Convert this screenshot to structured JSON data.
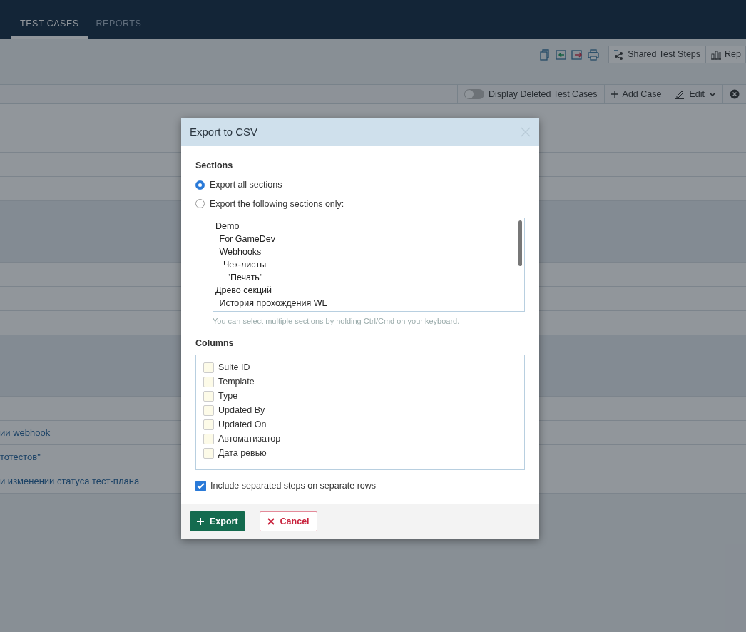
{
  "nav_tabs": [
    {
      "label": "TEST CASES",
      "selected": true
    },
    {
      "label": "REPORTS",
      "selected": false
    }
  ],
  "toolbar": {
    "buttons": [
      {
        "label": "Shared Test Steps",
        "kind": "steps"
      },
      {
        "label": "Rep",
        "kind": "report"
      }
    ]
  },
  "filter_bar": {
    "toggle": {
      "label": "Display Deleted Test Cases",
      "on": false
    },
    "buttons": [
      {
        "label": "Add Case",
        "kind": "add"
      },
      {
        "label": "Edit",
        "kind": "edit"
      }
    ]
  },
  "background_rows": [
    "ии webhook",
    "тотестов\"",
    "и изменении статуса тест-плана"
  ],
  "dialog": {
    "title": "Export to CSV",
    "sections_label": "Sections",
    "radios": [
      {
        "label": "Export all sections",
        "selected": true
      },
      {
        "label": "Export the following sections only:",
        "selected": false
      }
    ],
    "sections_list": [
      {
        "label": "Demo",
        "children": [
          {
            "label": "For GameDev"
          },
          {
            "label": "Webhooks",
            "children": [
              {
                "label": "Чек-листы",
                "children": [
                  {
                    "label": "\"Печать\""
                  }
                ]
              }
            ]
          }
        ]
      },
      {
        "label": "Древо секций",
        "children": [
          {
            "label": "История прохождения WL"
          }
        ]
      }
    ],
    "hint": "You can select multiple sections by holding Ctrl/Cmd on your keyboard.",
    "columns_label": "Columns",
    "columns": [
      {
        "label": "Suite ID",
        "checked": false
      },
      {
        "label": "Template",
        "checked": false
      },
      {
        "label": "Type",
        "checked": false
      },
      {
        "label": "Updated By",
        "checked": false
      },
      {
        "label": "Updated On",
        "checked": false
      },
      {
        "label": "Автоматизатор",
        "checked": false
      },
      {
        "label": "Дата ревью",
        "checked": false
      }
    ],
    "include_steps": {
      "label": "Include separated steps on separate rows",
      "checked": true
    },
    "buttons": [
      {
        "label": "Export",
        "kind": "primary"
      },
      {
        "label": "Cancel",
        "kind": "cancel"
      }
    ]
  }
}
